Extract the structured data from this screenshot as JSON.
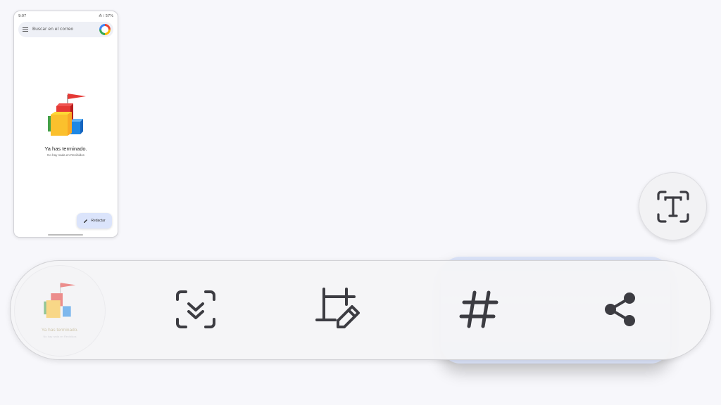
{
  "thumbnail": {
    "status_time": "9:07",
    "status_right": "⁂ ⁞ 57%",
    "search_placeholder": "Buscar en el correo",
    "empty_title": "Ya has terminado.",
    "empty_subtitle": "No hay nada en Recibidos",
    "compose_label": "Redactar"
  },
  "toolbar": {
    "preview_title": "Ya has terminado.",
    "preview_subtitle": "No hay nada en Recibidos",
    "tools": [
      {
        "icon": "scroll-capture-icon"
      },
      {
        "icon": "crop-edit-icon"
      },
      {
        "icon": "hashtag-icon"
      },
      {
        "icon": "share-icon"
      }
    ]
  },
  "floating": {
    "icon": "extract-text-icon"
  },
  "colors": {
    "icon": "#3c3c42",
    "highlight": "#c6d4f5",
    "red": "#e53935",
    "yellow": "#fbc02d",
    "blue": "#1e88e5"
  }
}
